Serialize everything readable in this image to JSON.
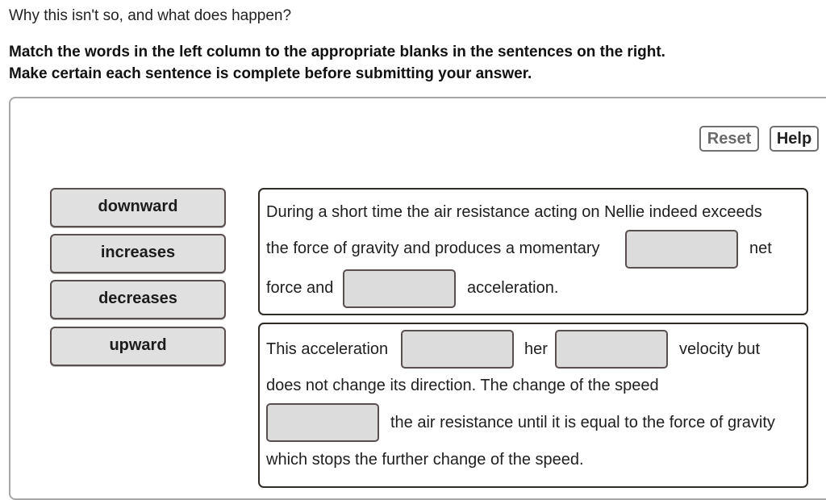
{
  "question": "Why this isn't so, and what does happen?",
  "instructions": {
    "line1": "Match the words in the left column to the appropriate blanks in the sentences on the right.",
    "line2": "Make certain each sentence is complete before submitting your answer."
  },
  "toolbar": {
    "reset_label": "Reset",
    "help_label": "Help"
  },
  "word_bank": [
    {
      "label": "downward"
    },
    {
      "label": "increases"
    },
    {
      "label": "decreases"
    },
    {
      "label": "upward"
    }
  ],
  "sentences": [
    {
      "line1": "During a short time the air resistance acting on Nellie indeed exceeds",
      "line2_a": "the force of gravity and produces a momentary",
      "line2_b": "net",
      "line3_a": "force and",
      "line3_b": "acceleration.",
      "blanks": [
        {
          "value": ""
        },
        {
          "value": ""
        }
      ]
    },
    {
      "line1_a": "This acceleration",
      "line1_b": "her",
      "line1_c": "velocity but",
      "line2": "does not change its direction. The change of the speed",
      "line3": "the air resistance until it is equal to the force of gravity",
      "line4": "which stops the further change of the speed.",
      "blanks": [
        {
          "value": ""
        },
        {
          "value": ""
        },
        {
          "value": ""
        }
      ]
    }
  ]
}
